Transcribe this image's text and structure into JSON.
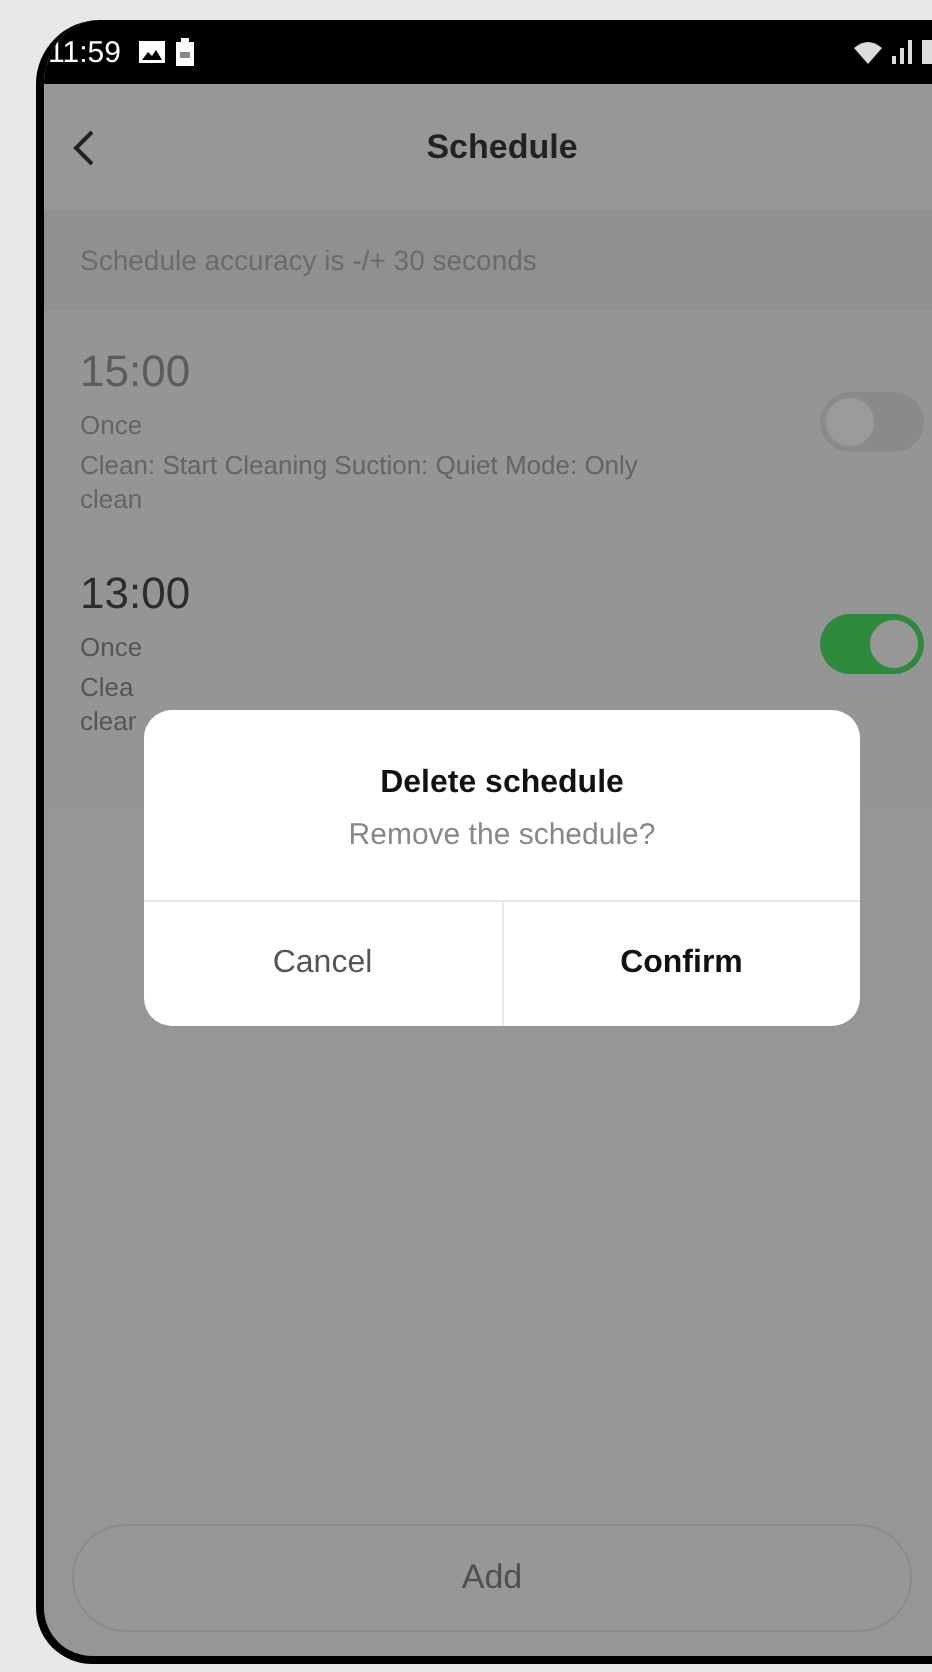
{
  "status_bar": {
    "time": "11:59"
  },
  "header": {
    "title": "Schedule"
  },
  "notice": "Schedule accuracy is -/+ 30 seconds",
  "schedules": [
    {
      "time": "15:00",
      "repeat": "Once",
      "description_lines": [
        "Clean: Start Cleaning Suction: Quiet Mode: Only",
        "clean"
      ],
      "on": false
    },
    {
      "time": "13:00",
      "repeat": "Once",
      "description_lines": [
        "Clea",
        "clear"
      ],
      "on": true
    }
  ],
  "add_button": "Add",
  "dialog": {
    "title": "Delete schedule",
    "message": "Remove the schedule?",
    "buttons": [
      {
        "label": "Cancel",
        "kind": "secondary"
      },
      {
        "label": "Confirm",
        "kind": "primary"
      }
    ]
  }
}
